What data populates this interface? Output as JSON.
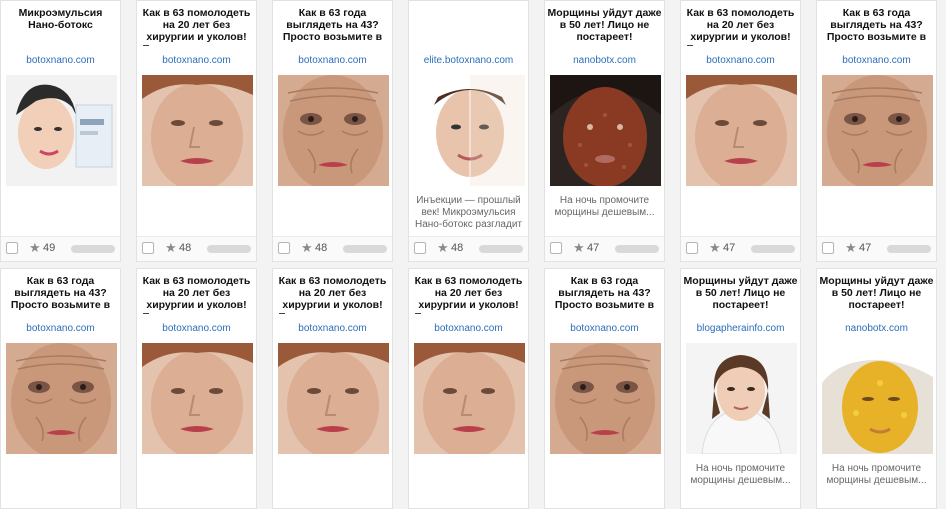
{
  "colors": {
    "title": "#111111",
    "domain": "#2a6ebb",
    "desc": "#666666",
    "card_bg": "#ffffff"
  },
  "rows": [
    [
      {
        "title": "Микроэмульсия Нано-ботокс",
        "domain": "botoxnano.com",
        "image": "woman-with-cream-box",
        "desc": "",
        "rating": "49"
      },
      {
        "title": "Как в 63 помолодеть на 20 лет без хирургии и уколов!",
        "domain": "botoxnano.com",
        "image": "older-woman-face",
        "desc": "",
        "rating": "48"
      },
      {
        "title": "Как в 63 года выглядеть на 43? Просто возьмите в",
        "domain": "botoxnano.com",
        "image": "wrinkled-face",
        "desc": "",
        "rating": "48"
      },
      {
        "title": "",
        "domain": "elite.botoxnano.com",
        "image": "before-after-face",
        "desc": "Инъекции — прошлый век! Микроэмульсия Нано-ботокс разгладит глубокие мимические",
        "rating": "48"
      },
      {
        "title": "Морщины уйдут даже в 50 лет! Лицо не постареет!",
        "domain": "nanobotx.com",
        "image": "clay-mask-face",
        "desc": "На ночь промочите морщины дешевым...",
        "rating": "47"
      },
      {
        "title": "Как в 63 помолодеть на 20 лет без хирургии и уколов!",
        "domain": "botoxnano.com",
        "image": "older-woman-face",
        "desc": "",
        "rating": "47"
      },
      {
        "title": "Как в 63 года выглядеть на 43? Просто возьмите в",
        "domain": "botoxnano.com",
        "image": "wrinkled-face",
        "desc": "",
        "rating": "47"
      }
    ],
    [
      {
        "title": "Как в 63 года выглядеть на 43? Просто возьмите в",
        "domain": "botoxnano.com",
        "image": "wrinkled-face",
        "desc": ""
      },
      {
        "title": "Как в 63 помолодеть на 20 лет без хирургии и уколов!",
        "domain": "botoxnano.com",
        "image": "older-woman-face",
        "desc": ""
      },
      {
        "title": "Как в 63 помолодеть на 20 лет без хирургии и уколов!",
        "domain": "botoxnano.com",
        "image": "older-woman-face",
        "desc": ""
      },
      {
        "title": "Как в 63 помолодеть на 20 лет без хирургии и уколов!",
        "domain": "botoxnano.com",
        "image": "older-woman-face",
        "desc": ""
      },
      {
        "title": "Как в 63 года выглядеть на 43? Просто возьмите в",
        "domain": "botoxnano.com",
        "image": "wrinkled-face",
        "desc": ""
      },
      {
        "title": "Морщины уйдут даже в 50 лет! Лицо не постареет!",
        "domain": "blogapherainfo.com",
        "image": "woman-portrait",
        "desc": "На ночь промочите морщины дешевым..."
      },
      {
        "title": "Морщины уйдут даже в 50 лет! Лицо не постареет!",
        "domain": "nanobotx.com",
        "image": "yellow-mask-face",
        "desc": "На ночь промочите морщины дешевым..."
      }
    ]
  ]
}
